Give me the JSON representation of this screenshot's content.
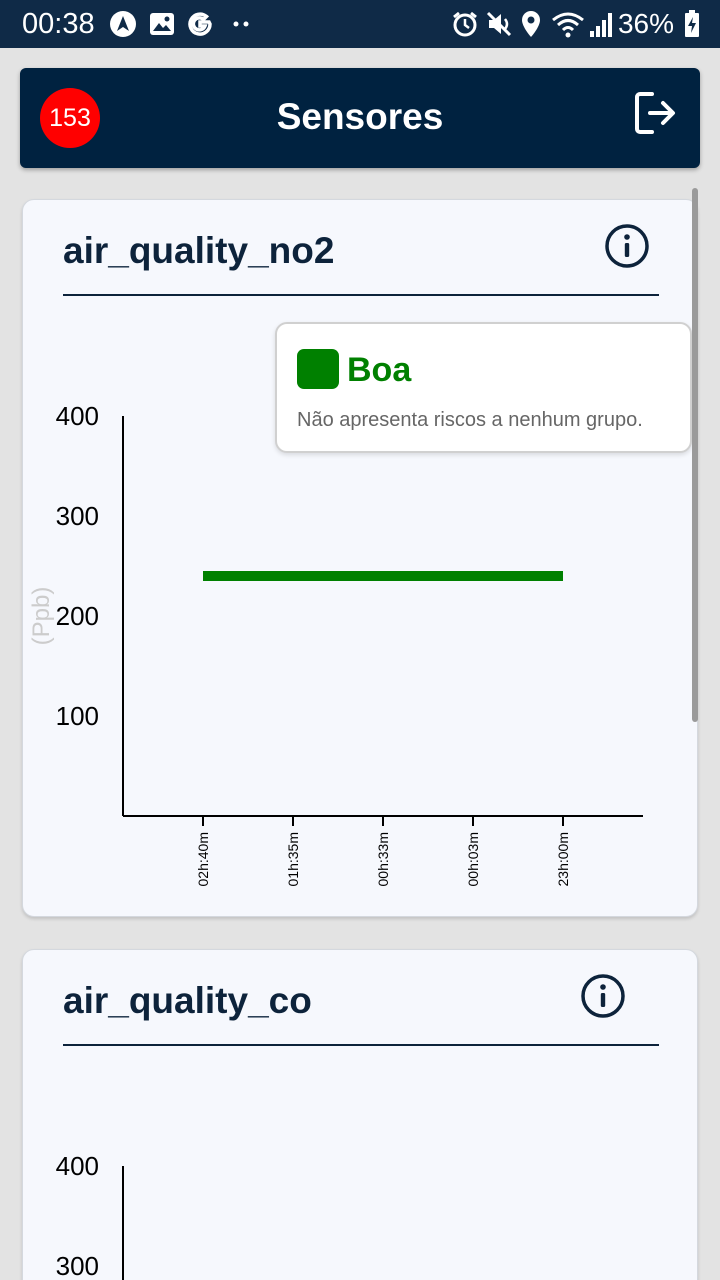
{
  "status_bar": {
    "time": "00:38",
    "battery": "36%",
    "icons": [
      "navigation-app-icon",
      "gallery-icon",
      "google-icon",
      "more-dots-icon",
      "alarm-icon",
      "mute-icon",
      "location-icon",
      "wifi-icon",
      "signal-icon",
      "battery-charging-icon"
    ]
  },
  "header": {
    "title": "Sensores",
    "badge_count": "153",
    "badge_color": "#ff0000",
    "background": "#002240",
    "logout_icon": "logout-icon"
  },
  "cards": [
    {
      "title": "air_quality_no2",
      "info_icon": "info-icon",
      "chart_data": {
        "type": "line",
        "ylabel": "(Ppb)",
        "y_ticks": [
          "400",
          "300",
          "200",
          "100"
        ],
        "ylim": [
          0,
          400
        ],
        "x": [
          "02h:40m",
          "01h:35m",
          "00h:33m",
          "00h:03m",
          "23h:00m"
        ],
        "series": [
          {
            "values": [
              240,
              240,
              240,
              240,
              240
            ],
            "color": "#008000"
          }
        ],
        "grid": false
      },
      "tooltip": {
        "title": "Boa",
        "description": "Não apresenta riscos a nenhum grupo.",
        "color": "#008000"
      }
    },
    {
      "title": "air_quality_co",
      "info_icon": "info-icon",
      "chart_data": {
        "type": "line",
        "y_ticks": [
          "400",
          "300"
        ],
        "ylim": [
          0,
          400
        ]
      }
    }
  ]
}
